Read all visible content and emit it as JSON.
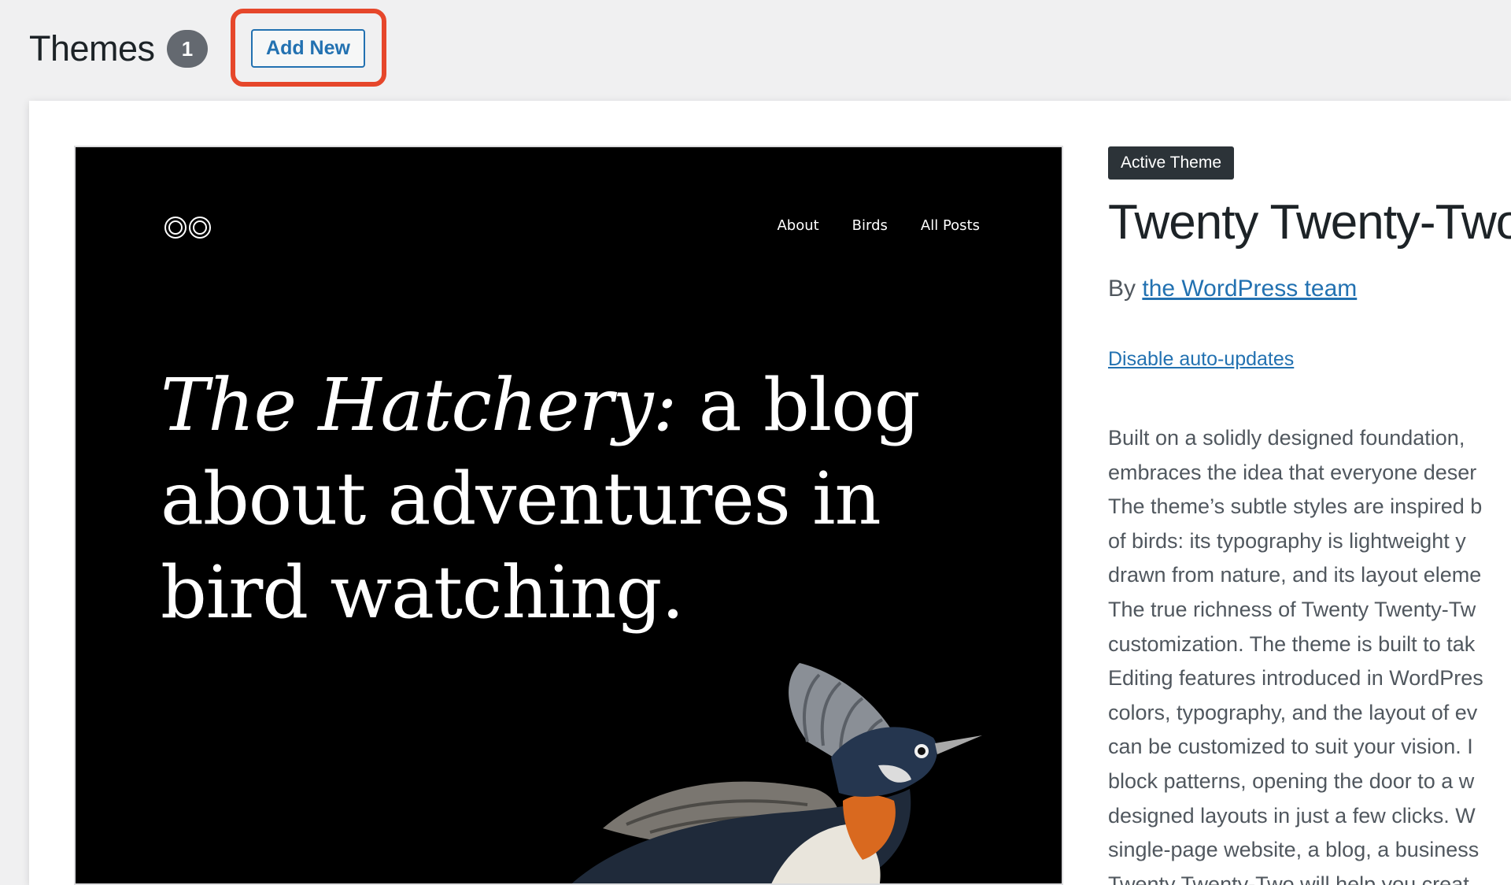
{
  "header": {
    "title": "Themes",
    "count": "1",
    "add_new_label": "Add New"
  },
  "preview": {
    "nav": [
      "About",
      "Birds",
      "All Posts"
    ],
    "hero_italic": "The Hatchery:",
    "hero_rest_line1": " a blog",
    "hero_line2": "about adventures in",
    "hero_line3": "bird watching."
  },
  "theme_info": {
    "active_badge": "Active Theme",
    "name": "Twenty Twenty-Two",
    "by_label": "By ",
    "author": "the WordPress team",
    "auto_updates_link": "Disable auto-updates",
    "description_lines": [
      "Built on a solidly designed foundation,",
      "embraces the idea that everyone deser",
      "The theme’s subtle styles are inspired b",
      "of birds: its typography is lightweight y",
      "drawn from nature, and its layout eleme",
      "The true richness of Twenty Twenty-Tw",
      "customization. The theme is built to tak",
      "Editing features introduced in WordPres",
      "colors, typography, and the layout of ev",
      "can be customized to suit your vision. I",
      "block patterns, opening the door to a w",
      "designed layouts in just a few clicks. W",
      "single-page website, a blog, a business",
      "Twenty Twenty-Two will help you creat"
    ]
  },
  "colors": {
    "accent": "#2271b1",
    "highlight": "#e6472b",
    "badge_dark": "#2c3338",
    "count_badge": "#646970"
  }
}
